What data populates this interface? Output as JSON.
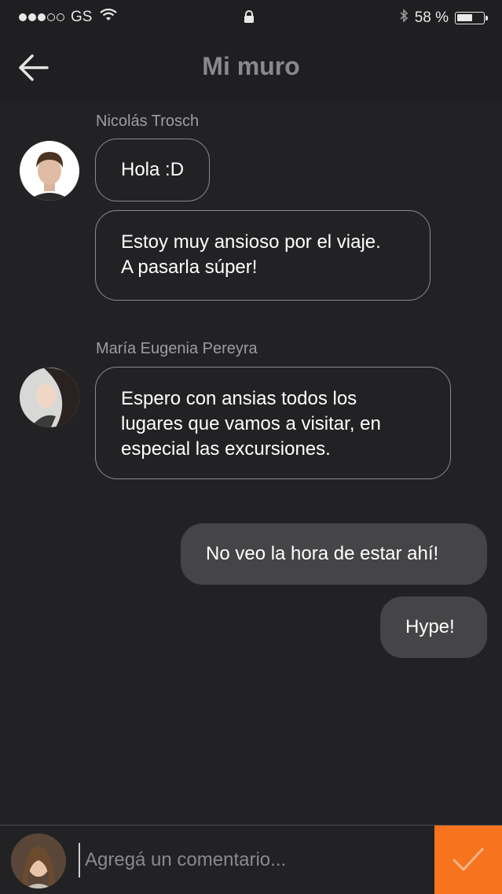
{
  "status_bar": {
    "carrier": "GS",
    "signal_bars_filled": 3,
    "signal_bars_total": 5,
    "battery_text": "58 %",
    "battery_level": 0.58,
    "icons": [
      "wifi-icon",
      "lock-icon",
      "bluetooth-icon",
      "battery-icon"
    ]
  },
  "header": {
    "title": "Mi muro",
    "back_icon": "arrow-left-icon"
  },
  "messages": [
    {
      "sender": "Nicolás Trosch",
      "bubbles": [
        "Hola :D",
        "Estoy muy ansioso por el viaje.\nA pasarla súper!"
      ]
    },
    {
      "sender": "María Eugenia Pereyra",
      "bubbles": [
        "Espero con ansias todos los\nlugares que vamos a visitar, en\nespecial las excursiones."
      ]
    },
    {
      "sender": "",
      "outgoing": true,
      "bubbles": [
        "No veo la hora de estar ahí!",
        "Hype!"
      ]
    }
  ],
  "composer": {
    "placeholder": "Agregá un comentario...",
    "value": "",
    "send_icon": "checkmark-icon"
  },
  "colors": {
    "background": "#222123",
    "bar": "#1f1e20",
    "accent": "#f7731d",
    "outgoing_bubble": "#454446",
    "incoming_border": "#8b8a8c"
  }
}
